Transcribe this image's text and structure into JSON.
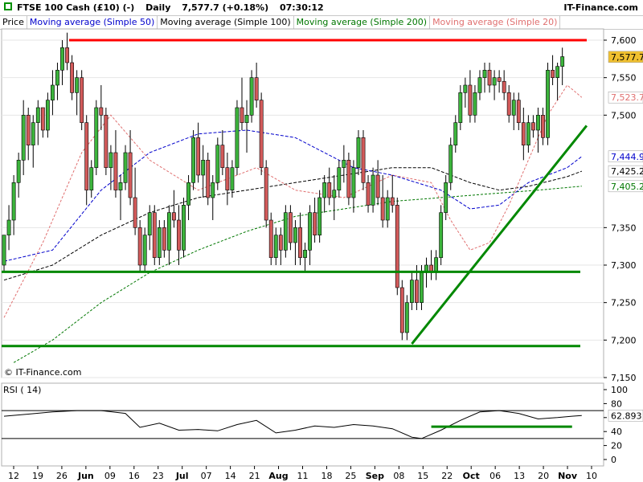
{
  "header": {
    "symbol": "FTSE 100 Cash (£10) (-)",
    "interval": "Daily",
    "quote": "7,577.7 (+0.18%)",
    "time": "07:30:12",
    "brand": "IT-Finance.com",
    "icon": "ftse-icon"
  },
  "legend": [
    {
      "label": "Price",
      "color": "#000000"
    },
    {
      "label": "Moving average (Simple 50)",
      "color": "#0000cc"
    },
    {
      "label": "Moving average (Simple 100)",
      "color": "#000000"
    },
    {
      "label": "Moving average (Simple 200)",
      "color": "#007700"
    },
    {
      "label": "Moving average (Simple 20)",
      "color": "#e07070"
    }
  ],
  "watermark": "© IT-Finance.com",
  "rsi_title": "RSI ( 14)",
  "chart_data": {
    "type": "candlestick",
    "price_axis": {
      "ticks": [
        "7,600",
        "7,550",
        "7,500",
        "7,350",
        "7,300",
        "7,250",
        "7,200",
        "7,150"
      ],
      "ylim": [
        7150,
        7615
      ]
    },
    "rsi_axis": {
      "ticks": [
        "100",
        "80",
        "60",
        "40",
        "20",
        "0"
      ],
      "ylim": [
        0,
        100
      ]
    },
    "x_ticks": [
      "12",
      "19",
      "26",
      "Jun",
      "09",
      "16",
      "23",
      "Jul",
      "07",
      "14",
      "21",
      "Aug",
      "11",
      "18",
      "25",
      "Sep",
      "08",
      "15",
      "22",
      "Oct",
      "06",
      "13",
      "20",
      "Nov",
      "10"
    ],
    "last_labels": [
      {
        "value": 7577.7,
        "text": "7,577.7",
        "color": "#000000",
        "bg": "#f0c030"
      },
      {
        "value": 7523.7,
        "text": "7,523.7",
        "color": "#e07070",
        "bg": "#ffffff"
      },
      {
        "value": 7444.9,
        "text": "7,444.9",
        "color": "#0000cc",
        "bg": "#ffffff"
      },
      {
        "value": 7425.2,
        "text": "7,425.2",
        "color": "#000000",
        "bg": "#ffffff"
      },
      {
        "value": 7405.2,
        "text": "7,405.2",
        "color": "#007700",
        "bg": "#ffffff"
      }
    ],
    "rsi_last": {
      "value": 62.893,
      "text": "62.893"
    },
    "candles": [
      [
        7300,
        7340,
        7290,
        7340
      ],
      [
        7340,
        7380,
        7320,
        7360
      ],
      [
        7360,
        7420,
        7340,
        7410
      ],
      [
        7410,
        7450,
        7390,
        7440
      ],
      [
        7440,
        7520,
        7420,
        7500
      ],
      [
        7500,
        7510,
        7440,
        7460
      ],
      [
        7460,
        7500,
        7430,
        7490
      ],
      [
        7490,
        7520,
        7460,
        7510
      ],
      [
        7510,
        7510,
        7470,
        7480
      ],
      [
        7480,
        7530,
        7470,
        7520
      ],
      [
        7520,
        7560,
        7500,
        7540
      ],
      [
        7540,
        7570,
        7520,
        7560
      ],
      [
        7560,
        7600,
        7540,
        7590
      ],
      [
        7590,
        7610,
        7560,
        7570
      ],
      [
        7570,
        7580,
        7520,
        7530
      ],
      [
        7530,
        7560,
        7500,
        7550
      ],
      [
        7550,
        7560,
        7480,
        7490
      ],
      [
        7490,
        7500,
        7380,
        7400
      ],
      [
        7400,
        7440,
        7390,
        7430
      ],
      [
        7430,
        7520,
        7420,
        7510
      ],
      [
        7510,
        7540,
        7480,
        7500
      ],
      [
        7500,
        7510,
        7420,
        7430
      ],
      [
        7430,
        7460,
        7400,
        7450
      ],
      [
        7450,
        7480,
        7390,
        7400
      ],
      [
        7400,
        7420,
        7360,
        7410
      ],
      [
        7410,
        7460,
        7400,
        7450
      ],
      [
        7450,
        7480,
        7380,
        7390
      ],
      [
        7390,
        7430,
        7340,
        7350
      ],
      [
        7350,
        7360,
        7290,
        7300
      ],
      [
        7300,
        7350,
        7290,
        7340
      ],
      [
        7340,
        7380,
        7320,
        7370
      ],
      [
        7370,
        7380,
        7300,
        7310
      ],
      [
        7310,
        7360,
        7300,
        7350
      ],
      [
        7350,
        7360,
        7310,
        7320
      ],
      [
        7320,
        7380,
        7300,
        7370
      ],
      [
        7370,
        7400,
        7350,
        7360
      ],
      [
        7360,
        7380,
        7300,
        7320
      ],
      [
        7320,
        7390,
        7310,
        7380
      ],
      [
        7380,
        7420,
        7360,
        7410
      ],
      [
        7410,
        7480,
        7400,
        7470
      ],
      [
        7470,
        7490,
        7410,
        7420
      ],
      [
        7420,
        7460,
        7390,
        7440
      ],
      [
        7440,
        7450,
        7380,
        7390
      ],
      [
        7390,
        7420,
        7360,
        7410
      ],
      [
        7410,
        7470,
        7400,
        7460
      ],
      [
        7460,
        7480,
        7420,
        7430
      ],
      [
        7430,
        7450,
        7380,
        7400
      ],
      [
        7400,
        7440,
        7390,
        7430
      ],
      [
        7430,
        7520,
        7420,
        7510
      ],
      [
        7510,
        7550,
        7480,
        7490
      ],
      [
        7490,
        7520,
        7450,
        7500
      ],
      [
        7500,
        7560,
        7490,
        7550
      ],
      [
        7550,
        7570,
        7510,
        7520
      ],
      [
        7520,
        7530,
        7420,
        7430
      ],
      [
        7430,
        7440,
        7350,
        7360
      ],
      [
        7360,
        7370,
        7300,
        7310
      ],
      [
        7310,
        7350,
        7300,
        7340
      ],
      [
        7340,
        7350,
        7300,
        7320
      ],
      [
        7320,
        7380,
        7310,
        7370
      ],
      [
        7370,
        7380,
        7320,
        7330
      ],
      [
        7330,
        7360,
        7300,
        7350
      ],
      [
        7350,
        7370,
        7300,
        7310
      ],
      [
        7310,
        7330,
        7290,
        7320
      ],
      [
        7320,
        7380,
        7300,
        7370
      ],
      [
        7370,
        7390,
        7330,
        7340
      ],
      [
        7340,
        7400,
        7330,
        7390
      ],
      [
        7390,
        7420,
        7370,
        7410
      ],
      [
        7410,
        7430,
        7380,
        7390
      ],
      [
        7390,
        7420,
        7360,
        7400
      ],
      [
        7400,
        7440,
        7390,
        7430
      ],
      [
        7430,
        7460,
        7410,
        7440
      ],
      [
        7440,
        7450,
        7380,
        7390
      ],
      [
        7390,
        7440,
        7370,
        7430
      ],
      [
        7430,
        7480,
        7420,
        7470
      ],
      [
        7470,
        7480,
        7400,
        7410
      ],
      [
        7410,
        7420,
        7370,
        7380
      ],
      [
        7380,
        7430,
        7370,
        7420
      ],
      [
        7420,
        7440,
        7380,
        7390
      ],
      [
        7390,
        7420,
        7350,
        7360
      ],
      [
        7360,
        7400,
        7350,
        7390
      ],
      [
        7390,
        7420,
        7370,
        7380
      ],
      [
        7380,
        7390,
        7260,
        7270
      ],
      [
        7270,
        7280,
        7200,
        7210
      ],
      [
        7210,
        7260,
        7200,
        7250
      ],
      [
        7250,
        7290,
        7240,
        7280
      ],
      [
        7280,
        7300,
        7240,
        7250
      ],
      [
        7250,
        7300,
        7240,
        7290
      ],
      [
        7290,
        7310,
        7270,
        7300
      ],
      [
        7300,
        7320,
        7280,
        7290
      ],
      [
        7290,
        7320,
        7280,
        7310
      ],
      [
        7310,
        7380,
        7300,
        7370
      ],
      [
        7370,
        7420,
        7360,
        7410
      ],
      [
        7410,
        7470,
        7400,
        7460
      ],
      [
        7460,
        7500,
        7450,
        7490
      ],
      [
        7490,
        7540,
        7480,
        7530
      ],
      [
        7530,
        7550,
        7510,
        7540
      ],
      [
        7540,
        7560,
        7490,
        7500
      ],
      [
        7500,
        7540,
        7490,
        7530
      ],
      [
        7530,
        7560,
        7520,
        7550
      ],
      [
        7550,
        7570,
        7530,
        7560
      ],
      [
        7560,
        7570,
        7530,
        7540
      ],
      [
        7540,
        7560,
        7520,
        7550
      ],
      [
        7550,
        7560,
        7530,
        7545
      ],
      [
        7545,
        7560,
        7520,
        7530
      ],
      [
        7530,
        7540,
        7490,
        7500
      ],
      [
        7500,
        7530,
        7480,
        7520
      ],
      [
        7520,
        7530,
        7480,
        7490
      ],
      [
        7490,
        7510,
        7440,
        7460
      ],
      [
        7460,
        7500,
        7450,
        7490
      ],
      [
        7490,
        7500,
        7470,
        7480
      ],
      [
        7480,
        7510,
        7450,
        7500
      ],
      [
        7500,
        7510,
        7460,
        7470
      ],
      [
        7470,
        7570,
        7460,
        7560
      ],
      [
        7560,
        7580,
        7540,
        7550
      ],
      [
        7550,
        7570,
        7520,
        7565
      ],
      [
        7565,
        7590,
        7540,
        7578
      ]
    ],
    "ma20": [
      [
        0,
        7230
      ],
      [
        8,
        7330
      ],
      [
        16,
        7450
      ],
      [
        22,
        7500
      ],
      [
        30,
        7440
      ],
      [
        40,
        7400
      ],
      [
        52,
        7430
      ],
      [
        60,
        7400
      ],
      [
        70,
        7390
      ],
      [
        80,
        7420
      ],
      [
        88,
        7410
      ],
      [
        92,
        7360
      ],
      [
        96,
        7320
      ],
      [
        100,
        7330
      ],
      [
        104,
        7380
      ],
      [
        108,
        7440
      ],
      [
        112,
        7500
      ],
      [
        116,
        7540
      ],
      [
        119,
        7523.7
      ]
    ],
    "ma50": [
      [
        0,
        7305
      ],
      [
        10,
        7320
      ],
      [
        20,
        7400
      ],
      [
        30,
        7450
      ],
      [
        40,
        7475
      ],
      [
        50,
        7480
      ],
      [
        60,
        7470
      ],
      [
        72,
        7430
      ],
      [
        80,
        7420
      ],
      [
        90,
        7400
      ],
      [
        96,
        7375
      ],
      [
        102,
        7380
      ],
      [
        108,
        7410
      ],
      [
        116,
        7430
      ],
      [
        119,
        7444.9
      ]
    ],
    "ma100": [
      [
        0,
        7280
      ],
      [
        10,
        7300
      ],
      [
        20,
        7340
      ],
      [
        30,
        7370
      ],
      [
        40,
        7390
      ],
      [
        50,
        7400
      ],
      [
        60,
        7410
      ],
      [
        70,
        7420
      ],
      [
        80,
        7430
      ],
      [
        88,
        7430
      ],
      [
        96,
        7410
      ],
      [
        102,
        7400
      ],
      [
        108,
        7405
      ],
      [
        116,
        7418
      ],
      [
        119,
        7425.2
      ]
    ],
    "ma200": [
      [
        2,
        7170
      ],
      [
        10,
        7200
      ],
      [
        20,
        7250
      ],
      [
        30,
        7290
      ],
      [
        40,
        7320
      ],
      [
        50,
        7345
      ],
      [
        60,
        7365
      ],
      [
        70,
        7375
      ],
      [
        80,
        7385
      ],
      [
        90,
        7390
      ],
      [
        100,
        7395
      ],
      [
        110,
        7400
      ],
      [
        119,
        7405.2
      ]
    ],
    "rsi": [
      [
        0,
        62
      ],
      [
        5,
        65
      ],
      [
        10,
        68
      ],
      [
        15,
        70
      ],
      [
        20,
        70
      ],
      [
        25,
        66
      ],
      [
        28,
        46
      ],
      [
        32,
        52
      ],
      [
        36,
        42
      ],
      [
        40,
        43
      ],
      [
        44,
        41
      ],
      [
        48,
        50
      ],
      [
        52,
        56
      ],
      [
        56,
        38
      ],
      [
        60,
        42
      ],
      [
        64,
        48
      ],
      [
        68,
        46
      ],
      [
        72,
        50
      ],
      [
        76,
        48
      ],
      [
        80,
        44
      ],
      [
        84,
        32
      ],
      [
        86,
        30
      ],
      [
        90,
        42
      ],
      [
        94,
        56
      ],
      [
        98,
        68
      ],
      [
        102,
        70
      ],
      [
        106,
        66
      ],
      [
        110,
        58
      ],
      [
        114,
        60
      ],
      [
        117,
        62
      ],
      [
        119,
        62.893
      ]
    ],
    "hlines": [
      {
        "price": 7600,
        "color": "#ff0000"
      },
      {
        "price": 7291,
        "color": "#008800"
      },
      {
        "price": 7192,
        "color": "#008800"
      }
    ],
    "trendline": {
      "from": [
        84,
        7195
      ],
      "to": [
        120,
        7486
      ],
      "color": "#008800"
    },
    "rsi_support": {
      "from": [
        88,
        47
      ],
      "to": [
        117,
        47
      ],
      "color": "#008800"
    }
  }
}
